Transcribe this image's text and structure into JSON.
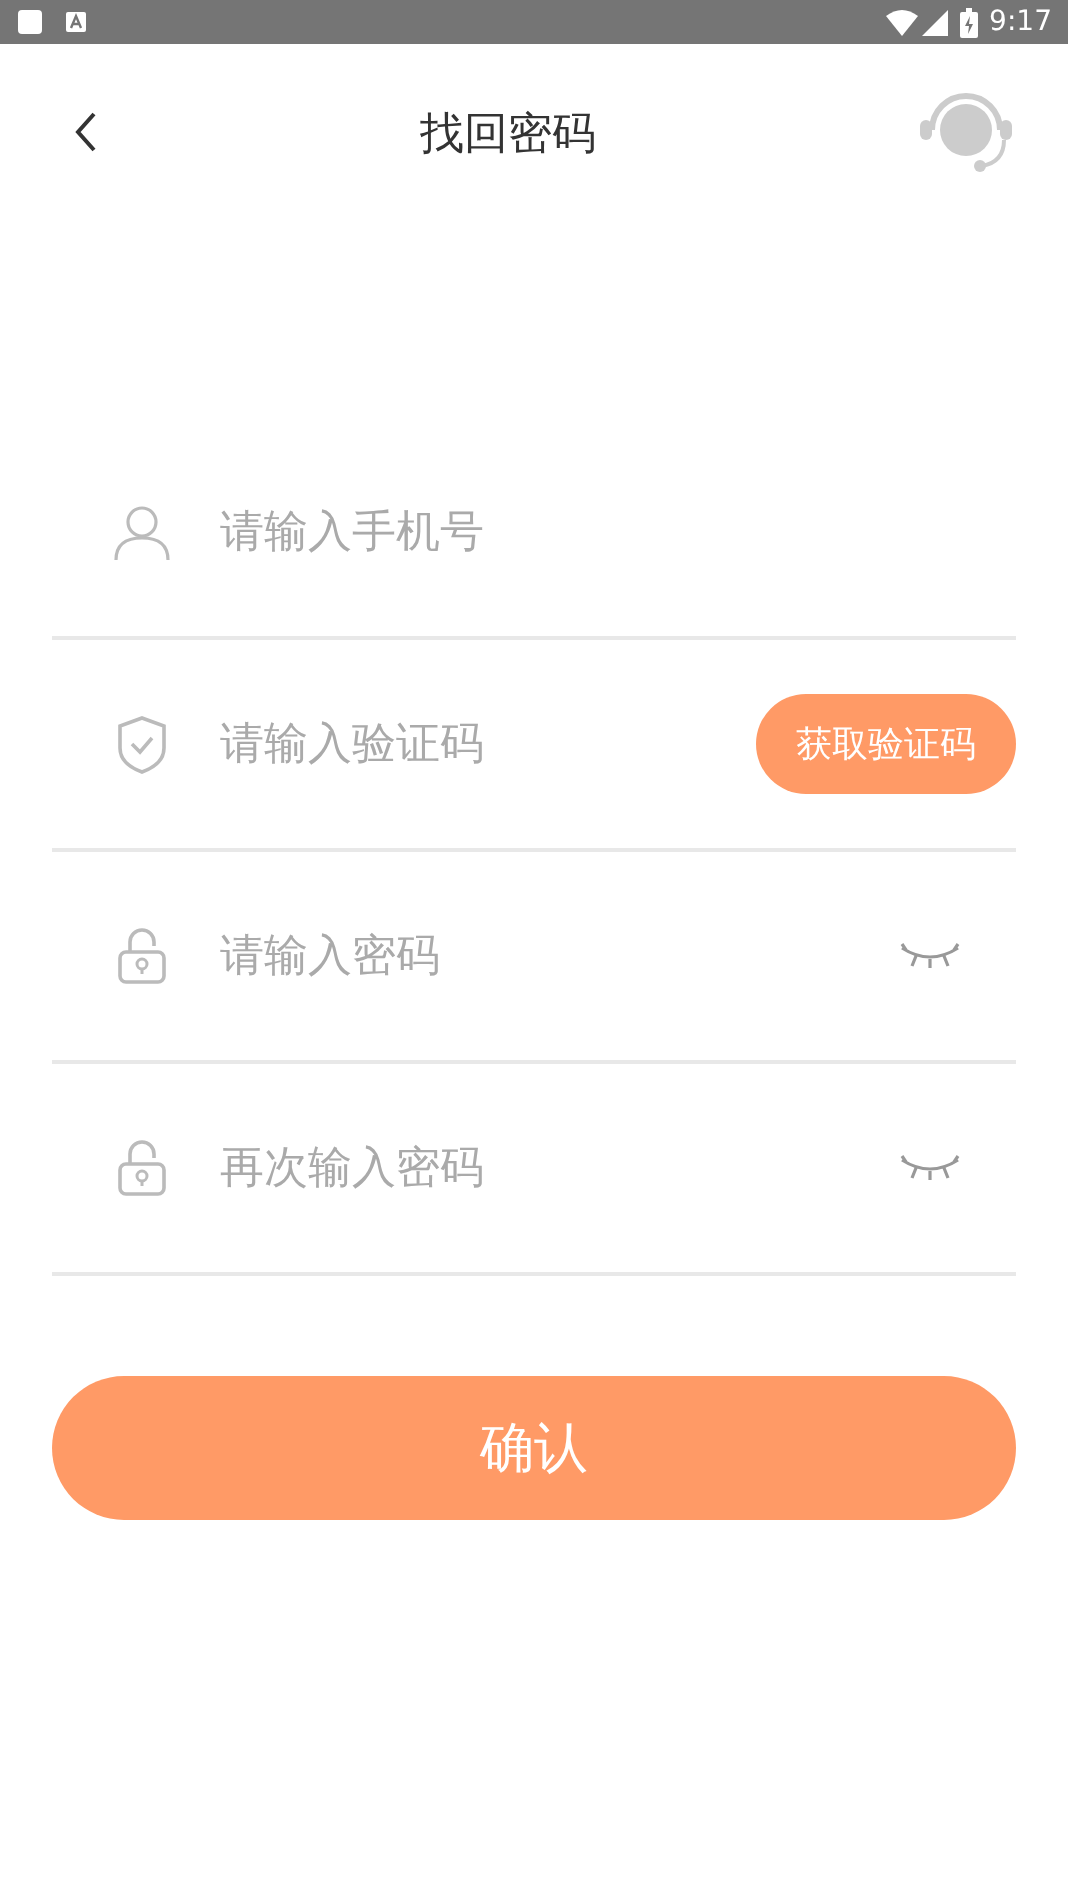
{
  "status_bar": {
    "time": "9:17"
  },
  "header": {
    "title": "找回密码"
  },
  "fields": [
    {
      "kind": "phone",
      "placeholder": "请输入手机号"
    },
    {
      "kind": "code",
      "placeholder": "请输入验证码",
      "action": "获取验证码"
    },
    {
      "kind": "password",
      "placeholder": "请输入密码",
      "password_visible": false
    },
    {
      "kind": "password",
      "placeholder": "再次输入密码",
      "password_visible": false
    }
  ],
  "submit": "确认"
}
